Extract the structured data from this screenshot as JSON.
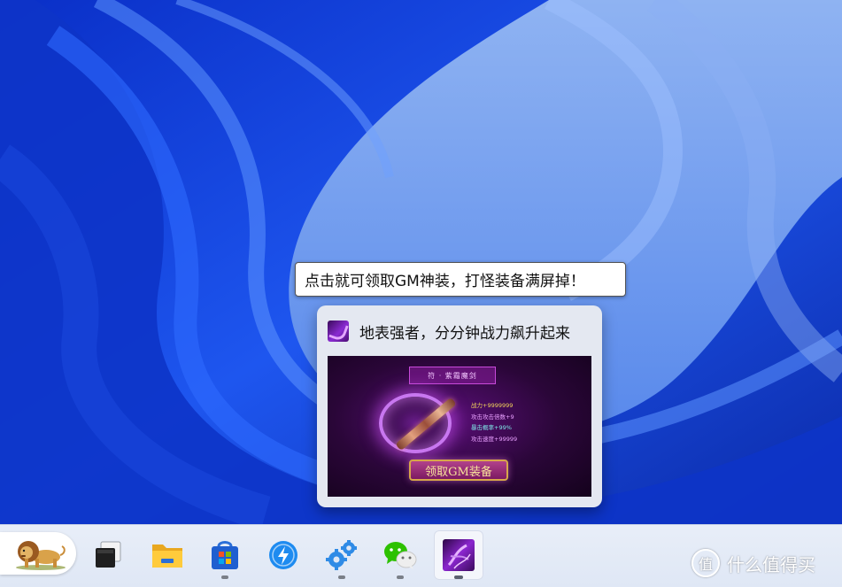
{
  "tooltip": {
    "text": "点击就可领取GM神装，打怪装备满屏掉！"
  },
  "preview": {
    "title": "地表强者，分分钟战力飙升起来",
    "thumbnail": {
      "banner": "符 · 紫霜魔剑",
      "stats": [
        "战力+9999999",
        "攻击攻击倍数+9",
        "暴击概率+99%",
        "攻击速度+99999"
      ],
      "claim_button": "领取GM装备"
    }
  },
  "taskbar": {
    "items": [
      {
        "name": "widgets",
        "icon": "lion-icon",
        "running": false
      },
      {
        "name": "task-view",
        "icon": "task-view-icon",
        "running": false
      },
      {
        "name": "file-explorer",
        "icon": "folder-icon",
        "running": false
      },
      {
        "name": "microsoft-store",
        "icon": "store-icon",
        "running": true
      },
      {
        "name": "app-lightning",
        "icon": "lightning-icon",
        "running": false
      },
      {
        "name": "settings",
        "icon": "gear-icon",
        "running": true
      },
      {
        "name": "wechat",
        "icon": "wechat-icon",
        "running": true
      },
      {
        "name": "game-app",
        "icon": "purple-game-icon",
        "running": true,
        "active": true
      }
    ]
  },
  "watermark": {
    "logo": "值",
    "text": "什么值得买"
  },
  "colors": {
    "wallpaper_blue": "#1b3fd6",
    "wallpaper_light": "#b8cdea",
    "game_purple": "#6a1d8c"
  }
}
